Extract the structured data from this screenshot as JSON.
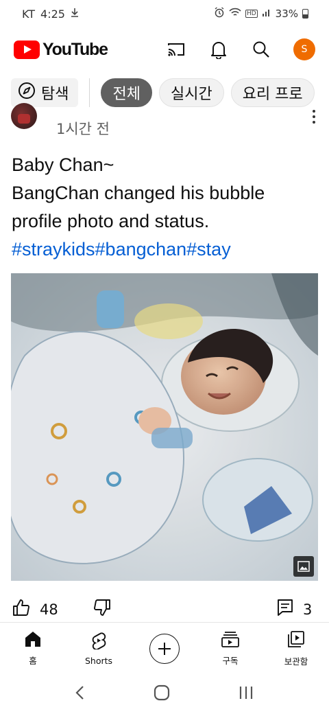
{
  "status_bar": {
    "carrier": "KT",
    "time": "4:25",
    "battery": "33%",
    "hd_badge": "HD"
  },
  "header": {
    "logo_text": "YouTube",
    "avatar_initial": "S",
    "brand_color": "#ff0000",
    "avatar_color": "#ef6c00"
  },
  "chips": {
    "explore_label": "탐색",
    "items": [
      {
        "label": "전체",
        "active": true
      },
      {
        "label": "실시간",
        "active": false
      },
      {
        "label": "요리 프로",
        "active": false
      }
    ]
  },
  "post": {
    "time_ago": "1시간 전",
    "line1": "Baby Chan~",
    "line2": "BangChan changed his bubble",
    "line3": "profile photo and status.",
    "hashtags": "#straykids#bangchan#stay",
    "image_alt": "baby photo",
    "likes": "48",
    "comments": "3",
    "link_color": "#065fd4"
  },
  "bottom_nav": {
    "home": "홈",
    "shorts": "Shorts",
    "subscriptions": "구독",
    "library": "보관함"
  },
  "icons": [
    "download-icon",
    "alarm-icon",
    "wifi-icon",
    "signal-icon",
    "battery-icon",
    "cast-icon",
    "bell-icon",
    "search-icon",
    "compass-icon",
    "more-vert-icon",
    "image-expand-icon",
    "thumbs-up-icon",
    "thumbs-down-icon",
    "comment-icon",
    "home-icon",
    "shorts-icon",
    "create-icon",
    "subscriptions-icon",
    "library-icon",
    "back-icon",
    "home-circle-icon",
    "recents-icon"
  ]
}
